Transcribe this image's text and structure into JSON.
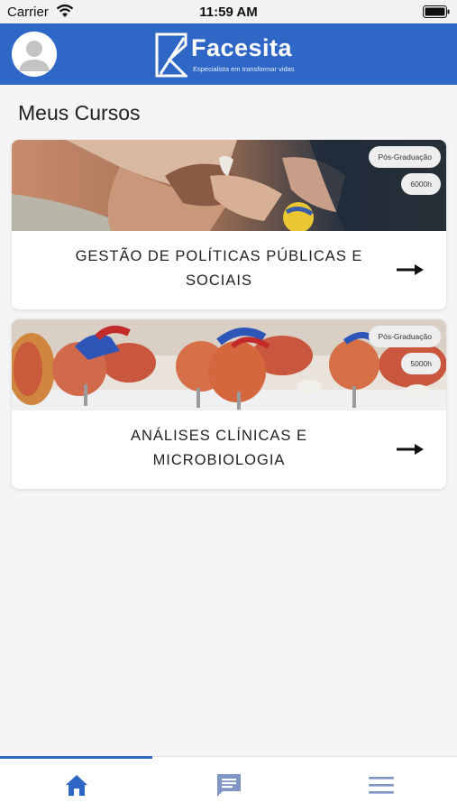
{
  "status_bar": {
    "carrier": "Carrier",
    "time": "11:59 AM"
  },
  "header": {
    "brand_name": "Facesita",
    "brand_tagline": "Especialista em transformar vidas",
    "avatar_icon": "user-avatar-icon"
  },
  "page": {
    "title": "Meus Cursos"
  },
  "courses": [
    {
      "type": "Pós-Graduação",
      "hours": "6000h",
      "title": "GESTÃO DE POLÍTICAS PÚBLICAS E SOCIAIS",
      "image": "elderly-hands-photo"
    },
    {
      "type": "Pós-Graduação",
      "hours": "5000h",
      "title": "ANÁLISES CLÍNICAS E MICROBIOLOGIA",
      "image": "heart-models-photo"
    }
  ],
  "tab_bar": {
    "items": [
      {
        "icon": "home-icon",
        "active": true
      },
      {
        "icon": "chat-icon",
        "active": false
      },
      {
        "icon": "menu-icon",
        "active": false
      }
    ],
    "active_color": "#2f67c7",
    "inactive_color": "#7f95c4"
  },
  "colors": {
    "brand": "#2f67c7",
    "background": "#f5f5f7",
    "card": "#ffffff"
  }
}
